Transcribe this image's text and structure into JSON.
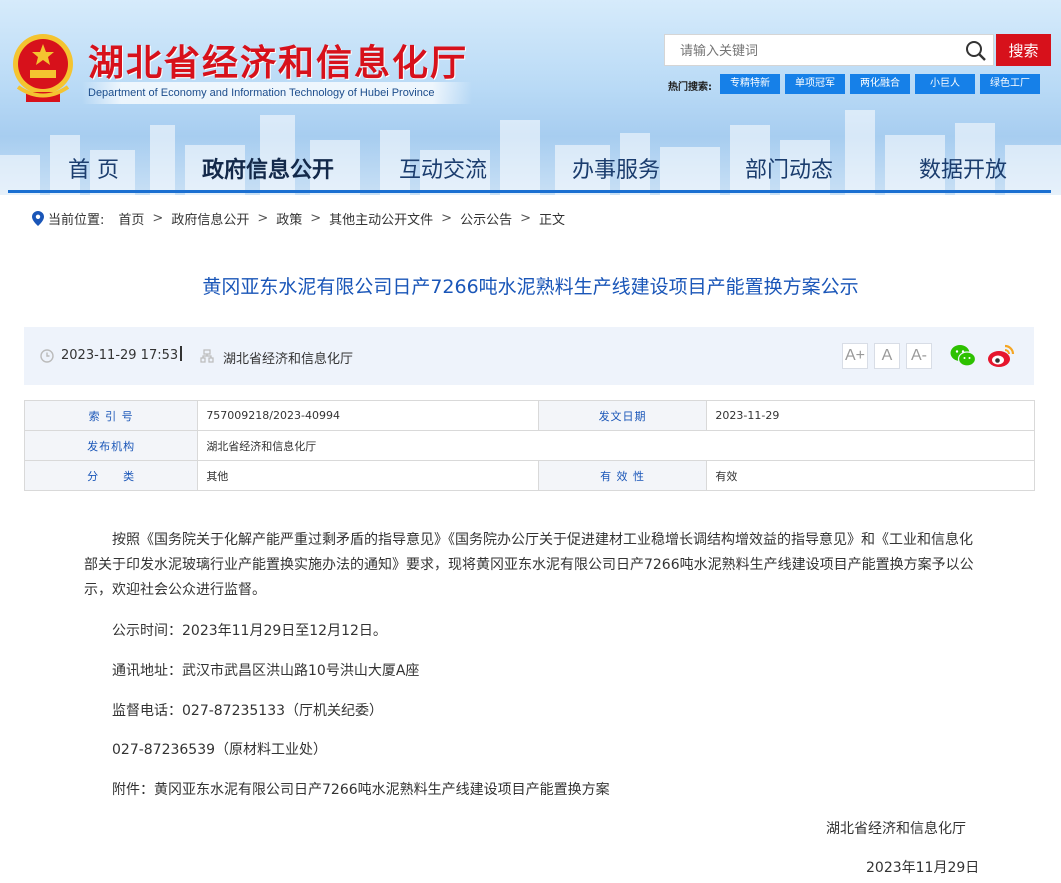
{
  "header": {
    "site_title": "湖北省经济和信息化厅",
    "site_subtitle": "Department of Economy and Information Technology of Hubei Province",
    "search_placeholder": "请输入关键词",
    "search_button": "搜索",
    "hot_label": "热门搜索:",
    "hot_tags": [
      "专精特新",
      "单项冠军",
      "两化融合",
      "小巨人",
      "绿色工厂"
    ],
    "accent_color": "#d7111b",
    "nav_color": "#1a6fd1"
  },
  "nav": {
    "items": [
      "首 页",
      "政府信息公开",
      "互动交流",
      "办事服务",
      "部门动态",
      "数据开放"
    ],
    "active_index": 1
  },
  "breadcrumb": {
    "label": "当前位置:",
    "items": [
      "首页",
      "政府信息公开",
      "政策",
      "其他主动公开文件",
      "公示公告",
      "正文"
    ],
    "separator": ">"
  },
  "article": {
    "title": "黄冈亚东水泥有限公司日产7266吨水泥熟料生产线建设项目产能置换方案公示",
    "date": "2023-11-29 17:53",
    "source": "湖北省经济和信息化厅",
    "font_buttons": [
      "A+",
      "A",
      "A-"
    ],
    "share_icons": [
      "wechat-icon",
      "weibo-icon"
    ]
  },
  "info": {
    "index_label": "索 引 号",
    "index_value": "757009218/2023-40994",
    "date_label": "发文日期",
    "date_value": "2023-11-29",
    "org_label": "发布机构",
    "org_value": "湖北省经济和信息化厅",
    "category_label": "分　　类",
    "category_value": "其他",
    "validity_label": "有 效 性",
    "validity_value": "有效"
  },
  "body": {
    "paragraph": "按照《国务院关于化解产能严重过剩矛盾的指导意见》《国务院办公厅关于促进建材工业稳增长调结构增效益的指导意见》和《工业和信息化部关于印发水泥玻璃行业产能置换实施办法的通知》要求，现将黄冈亚东水泥有限公司日产7266吨水泥熟料生产线建设项目产能置换方案予以公示，欢迎社会公众进行监督。",
    "publicity_time": "公示时间：2023年11月29日至12月12日。",
    "address": "通讯地址：武汉市武昌区洪山路10号洪山大厦A座",
    "phone1": "监督电话：027-87235133（厅机关纪委）",
    "phone2": "027-87236539（原材料工业处）",
    "attachment": "附件：黄冈亚东水泥有限公司日产7266吨水泥熟料生产线建设项目产能置换方案",
    "signature": "湖北省经济和信息化厅",
    "sign_date": "2023年11月29日"
  }
}
